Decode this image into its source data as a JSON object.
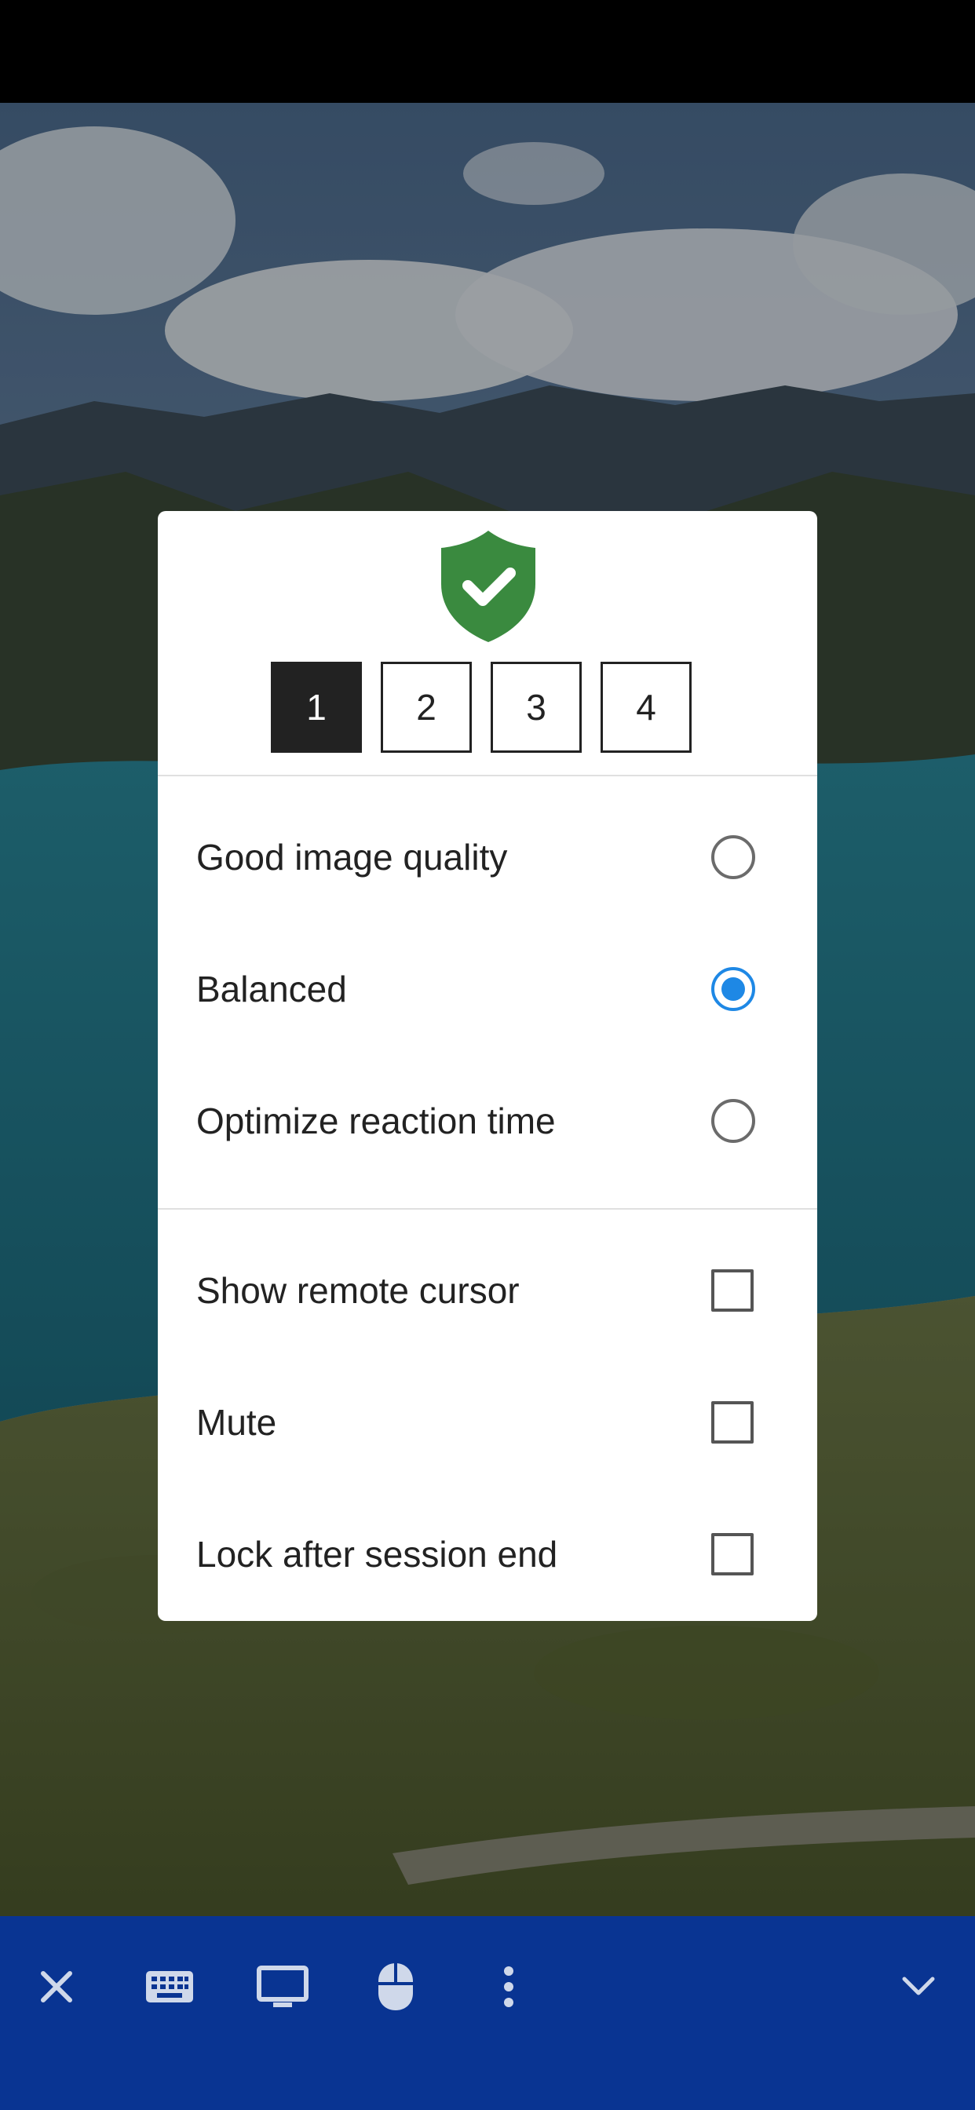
{
  "monitors": {
    "tabs": [
      "1",
      "2",
      "3",
      "4"
    ],
    "selected": "1"
  },
  "quality_options": [
    {
      "label": "Good image quality",
      "selected": false
    },
    {
      "label": "Balanced",
      "selected": true
    },
    {
      "label": "Optimize reaction time",
      "selected": false
    }
  ],
  "toggles": [
    {
      "label": "Show remote cursor",
      "checked": false
    },
    {
      "label": "Mute",
      "checked": false
    },
    {
      "label": "Lock after session end",
      "checked": false
    }
  ],
  "colors": {
    "toolbar": "#093492",
    "accent": "#1e88e5",
    "shield": "#3a8a3f",
    "selected_tab": "#222222"
  },
  "toolbar": {
    "icons": [
      "close-icon",
      "keyboard-icon",
      "monitor-icon",
      "mouse-icon",
      "more-vert-icon",
      "chevron-down-icon"
    ]
  }
}
